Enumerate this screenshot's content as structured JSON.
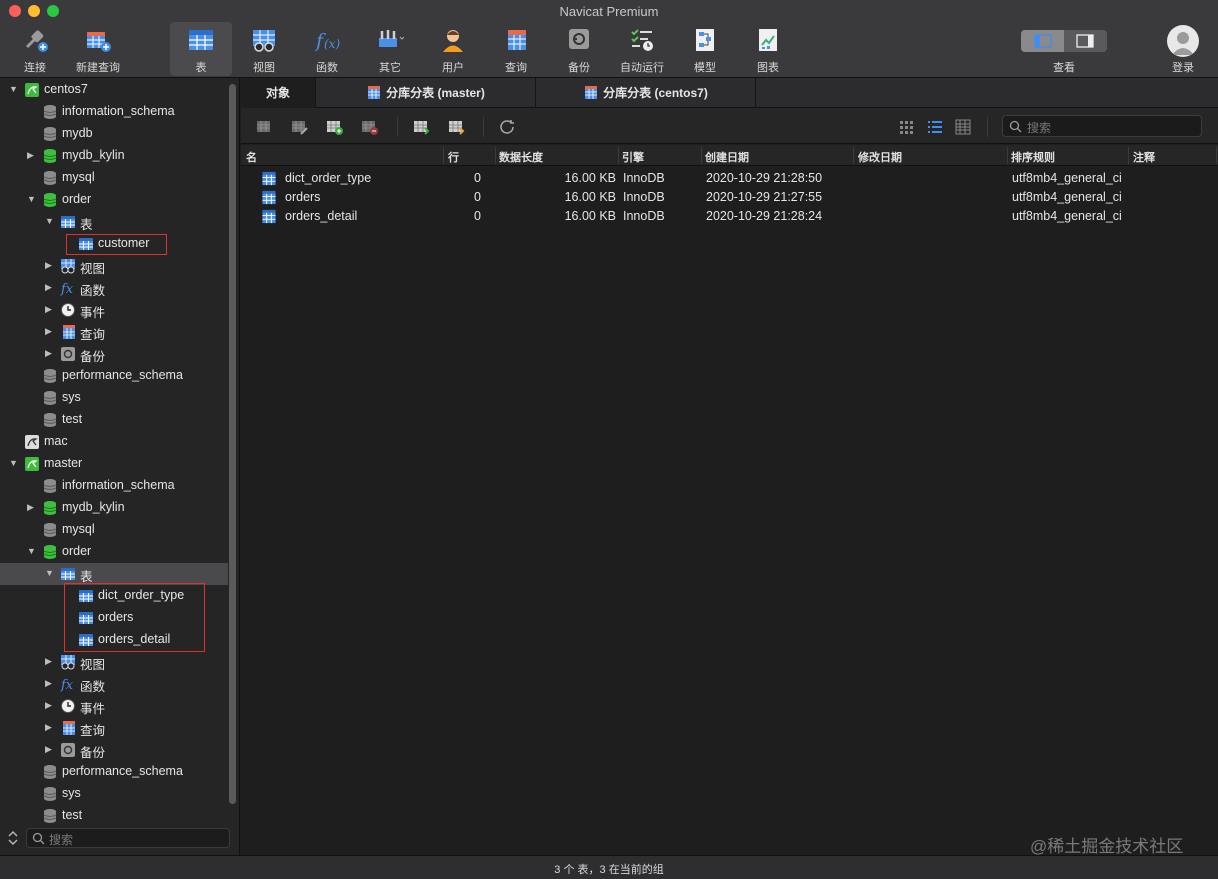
{
  "window": {
    "title": "Navicat Premium"
  },
  "toolbar": {
    "items": [
      {
        "label": "连接",
        "icon": "connect-plug-icon"
      },
      {
        "label": "新建查询",
        "icon": "new-query-icon"
      },
      {
        "label": "表",
        "icon": "table-icon",
        "active": true
      },
      {
        "label": "视图",
        "icon": "view-icon"
      },
      {
        "label": "函数",
        "icon": "function-fx-icon"
      },
      {
        "label": "其它",
        "icon": "tools-icon"
      },
      {
        "label": "用户",
        "icon": "user-icon"
      },
      {
        "label": "查询",
        "icon": "query-icon"
      },
      {
        "label": "备份",
        "icon": "backup-icon"
      },
      {
        "label": "自动运行",
        "icon": "automation-icon"
      },
      {
        "label": "模型",
        "icon": "model-icon"
      },
      {
        "label": "图表",
        "icon": "chart-icon"
      }
    ],
    "view_label": "查看",
    "login_label": "登录"
  },
  "sidebar": {
    "tree": [
      {
        "label": "centos7",
        "type": "connection",
        "expanded": true
      },
      {
        "label": "information_schema",
        "type": "db-gray"
      },
      {
        "label": "mydb",
        "type": "db-gray"
      },
      {
        "label": "mydb_kylin",
        "type": "db-green",
        "expanded": false
      },
      {
        "label": "mysql",
        "type": "db-gray"
      },
      {
        "label": "order",
        "type": "db-green",
        "expanded": true
      },
      {
        "label": "表",
        "type": "tables-folder",
        "expanded": true
      },
      {
        "label": "customer",
        "type": "table"
      },
      {
        "label": "视图",
        "type": "views-folder",
        "expanded": false
      },
      {
        "label": "函数",
        "type": "functions-folder",
        "expanded": false
      },
      {
        "label": "事件",
        "type": "events-folder",
        "expanded": false
      },
      {
        "label": "查询",
        "type": "queries-folder",
        "expanded": false
      },
      {
        "label": "备份",
        "type": "backups-folder",
        "expanded": false
      },
      {
        "label": "performance_schema",
        "type": "db-gray"
      },
      {
        "label": "sys",
        "type": "db-gray"
      },
      {
        "label": "test",
        "type": "db-gray"
      },
      {
        "label": "mac",
        "type": "connection-gray"
      },
      {
        "label": "master",
        "type": "connection",
        "expanded": true
      },
      {
        "label": "information_schema",
        "type": "db-gray"
      },
      {
        "label": "mydb_kylin",
        "type": "db-green",
        "expanded": false
      },
      {
        "label": "mysql",
        "type": "db-gray"
      },
      {
        "label": "order",
        "type": "db-green",
        "expanded": true
      },
      {
        "label": "表",
        "type": "tables-folder",
        "expanded": true,
        "selected": true
      },
      {
        "label": "dict_order_type",
        "type": "table"
      },
      {
        "label": "orders",
        "type": "table"
      },
      {
        "label": "orders_detail",
        "type": "table"
      },
      {
        "label": "视图",
        "type": "views-folder",
        "expanded": false
      },
      {
        "label": "函数",
        "type": "functions-folder",
        "expanded": false
      },
      {
        "label": "事件",
        "type": "events-folder",
        "expanded": false
      },
      {
        "label": "查询",
        "type": "queries-folder",
        "expanded": false
      },
      {
        "label": "备份",
        "type": "backups-folder",
        "expanded": false
      },
      {
        "label": "performance_schema",
        "type": "db-gray"
      },
      {
        "label": "sys",
        "type": "db-gray"
      },
      {
        "label": "test",
        "type": "db-gray"
      }
    ],
    "search_placeholder": "搜索"
  },
  "tabs": [
    {
      "label": "对象",
      "active": true
    },
    {
      "label": "分库分表 (master)"
    },
    {
      "label": "分库分表 (centos7)"
    }
  ],
  "objects": {
    "search_placeholder": "搜索",
    "columns": [
      "名",
      "行",
      "数据长度",
      "引擎",
      "创建日期",
      "修改日期",
      "排序规则",
      "注释"
    ],
    "rows": [
      {
        "name": "dict_order_type",
        "rows": "0",
        "data_length": "16.00 KB",
        "engine": "InnoDB",
        "created": "2020-10-29 21:28:50",
        "modified": "",
        "collation": "utf8mb4_general_ci",
        "comment": ""
      },
      {
        "name": "orders",
        "rows": "0",
        "data_length": "16.00 KB",
        "engine": "InnoDB",
        "created": "2020-10-29 21:27:55",
        "modified": "",
        "collation": "utf8mb4_general_ci",
        "comment": ""
      },
      {
        "name": "orders_detail",
        "rows": "0",
        "data_length": "16.00 KB",
        "engine": "InnoDB",
        "created": "2020-10-29 21:28:24",
        "modified": "",
        "collation": "utf8mb4_general_ci",
        "comment": ""
      }
    ]
  },
  "status": {
    "text": "3 个 表，3 在当前的组"
  },
  "watermark": "@稀土掘金技术社区",
  "colors": {
    "db_green": "#3fbf3f",
    "db_gray": "#8c8c8c",
    "table_blue": "#3a78d8",
    "highlight_red": "#e03030"
  }
}
